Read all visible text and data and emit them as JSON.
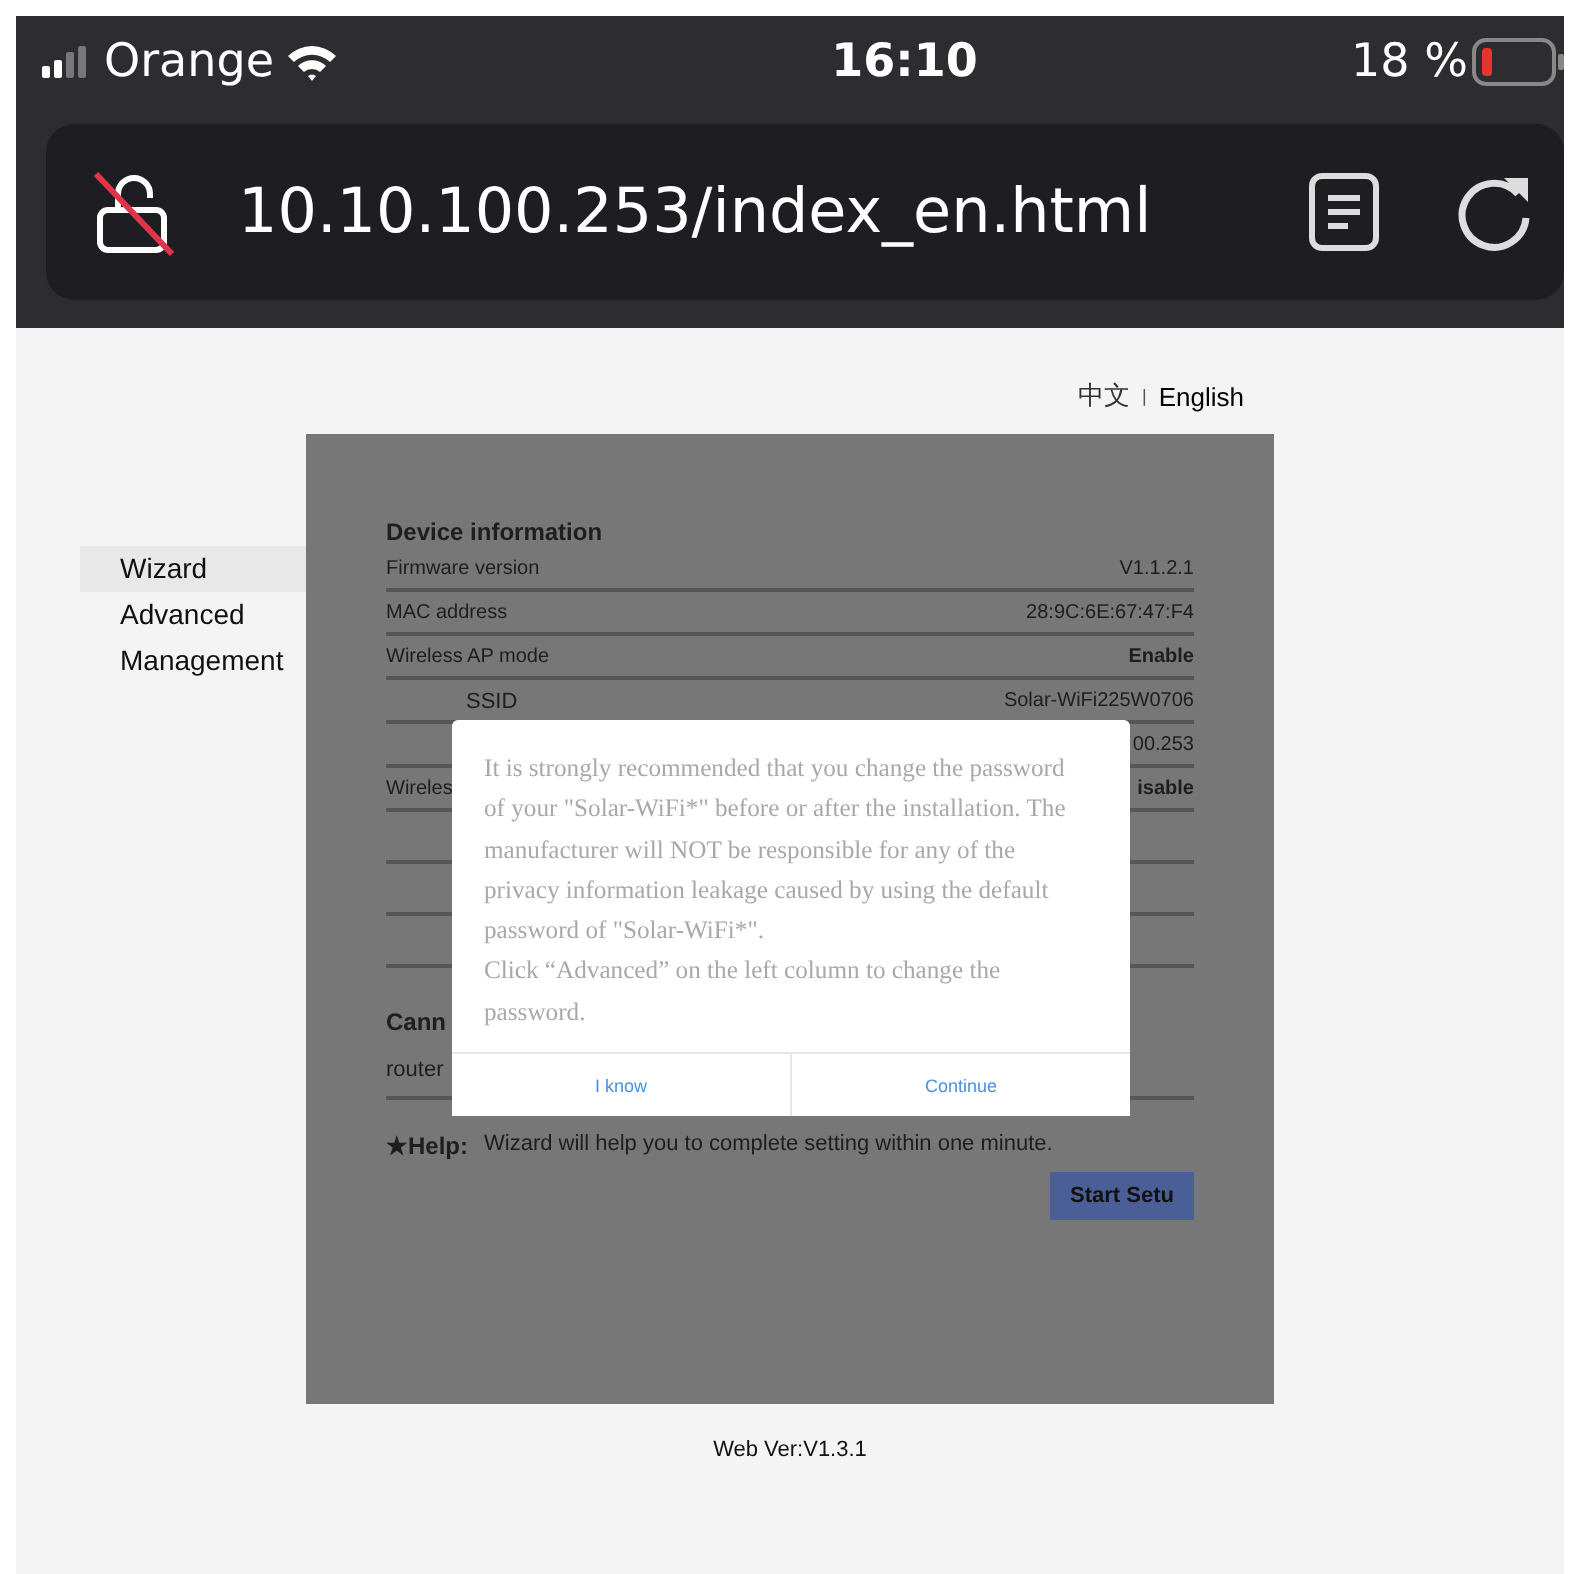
{
  "status_bar": {
    "carrier": "Orange",
    "time": "16:10",
    "battery": "18 %"
  },
  "address_bar": {
    "url": "10.10.100.253/index_en.html"
  },
  "languages": {
    "items": [
      {
        "label": "中文",
        "selected": false
      },
      {
        "label": "English",
        "selected": true
      }
    ],
    "separator": "|"
  },
  "sidebar": {
    "items": [
      {
        "label": "Wizard",
        "selected": true
      },
      {
        "label": "Advanced",
        "selected": false
      },
      {
        "label": "Management",
        "selected": false
      }
    ]
  },
  "device_info": {
    "heading": "Device information",
    "rows": [
      {
        "label": "Firmware version",
        "value": "V1.1.2.1",
        "kind": "text"
      },
      {
        "label": "MAC address",
        "value": "28:9C:6E:67:47:F4",
        "kind": "text"
      },
      {
        "label": "Wireless AP mode",
        "value": "Enable",
        "kind": "status",
        "children": [
          {
            "label": "SSID",
            "value": "Solar-WiFi225W0706",
            "kind": "text"
          },
          {
            "value": "00.253",
            "kind": "text"
          }
        ]
      },
      {
        "label": "Wireles",
        "value": "isable",
        "kind": "status"
      }
    ]
  },
  "connection": {
    "heading": "Cann",
    "field_label": "router"
  },
  "help": {
    "label": "★Help:",
    "text": "Wizard will help you to complete setting within one minute."
  },
  "start_button": "Start Setu",
  "dialog": {
    "message": [
      "It is strongly recommended that you change the password of your \"Solar-WiFi*\" before or after the installation. The manufacturer will NOT be responsible for any of the privacy information leakage caused by using the default password of \"Solar-WiFi*\".",
      "Click “Advanced” on the left column to change the password."
    ],
    "buttons": [
      "I know",
      "Continue"
    ]
  },
  "footer": "Web Ver:V1.3.1"
}
